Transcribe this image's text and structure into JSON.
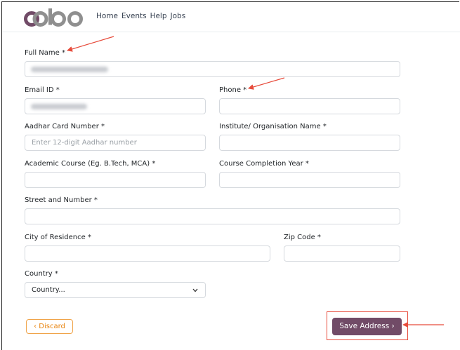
{
  "brand": {
    "logo_text": "odoo",
    "color": "#714b67"
  },
  "nav": {
    "items": [
      "Home",
      "Events",
      "Help",
      "Jobs"
    ]
  },
  "form": {
    "full_name": {
      "label": "Full Name *"
    },
    "email": {
      "label": "Email ID *"
    },
    "phone": {
      "label": "Phone *"
    },
    "aadhar": {
      "label": "Aadhar Card Number *",
      "placeholder": "Enter 12-digit Aadhar number"
    },
    "institute": {
      "label": "Institute/ Organisation Name *"
    },
    "course": {
      "label": "Academic Course (Eg. B.Tech, MCA) *"
    },
    "completion_year": {
      "label": "Course Completion Year *"
    },
    "street": {
      "label": "Street and Number *"
    },
    "city": {
      "label": "City of Residence *"
    },
    "zip": {
      "label": "Zip Code *"
    },
    "country": {
      "label": "Country *",
      "selected": "Country..."
    }
  },
  "actions": {
    "discard_label": "‹ Discard",
    "save_label": "Save Address ›"
  },
  "colors": {
    "accent": "#714b67",
    "discard": "#e8830c",
    "annotation": "#e74c3c"
  }
}
